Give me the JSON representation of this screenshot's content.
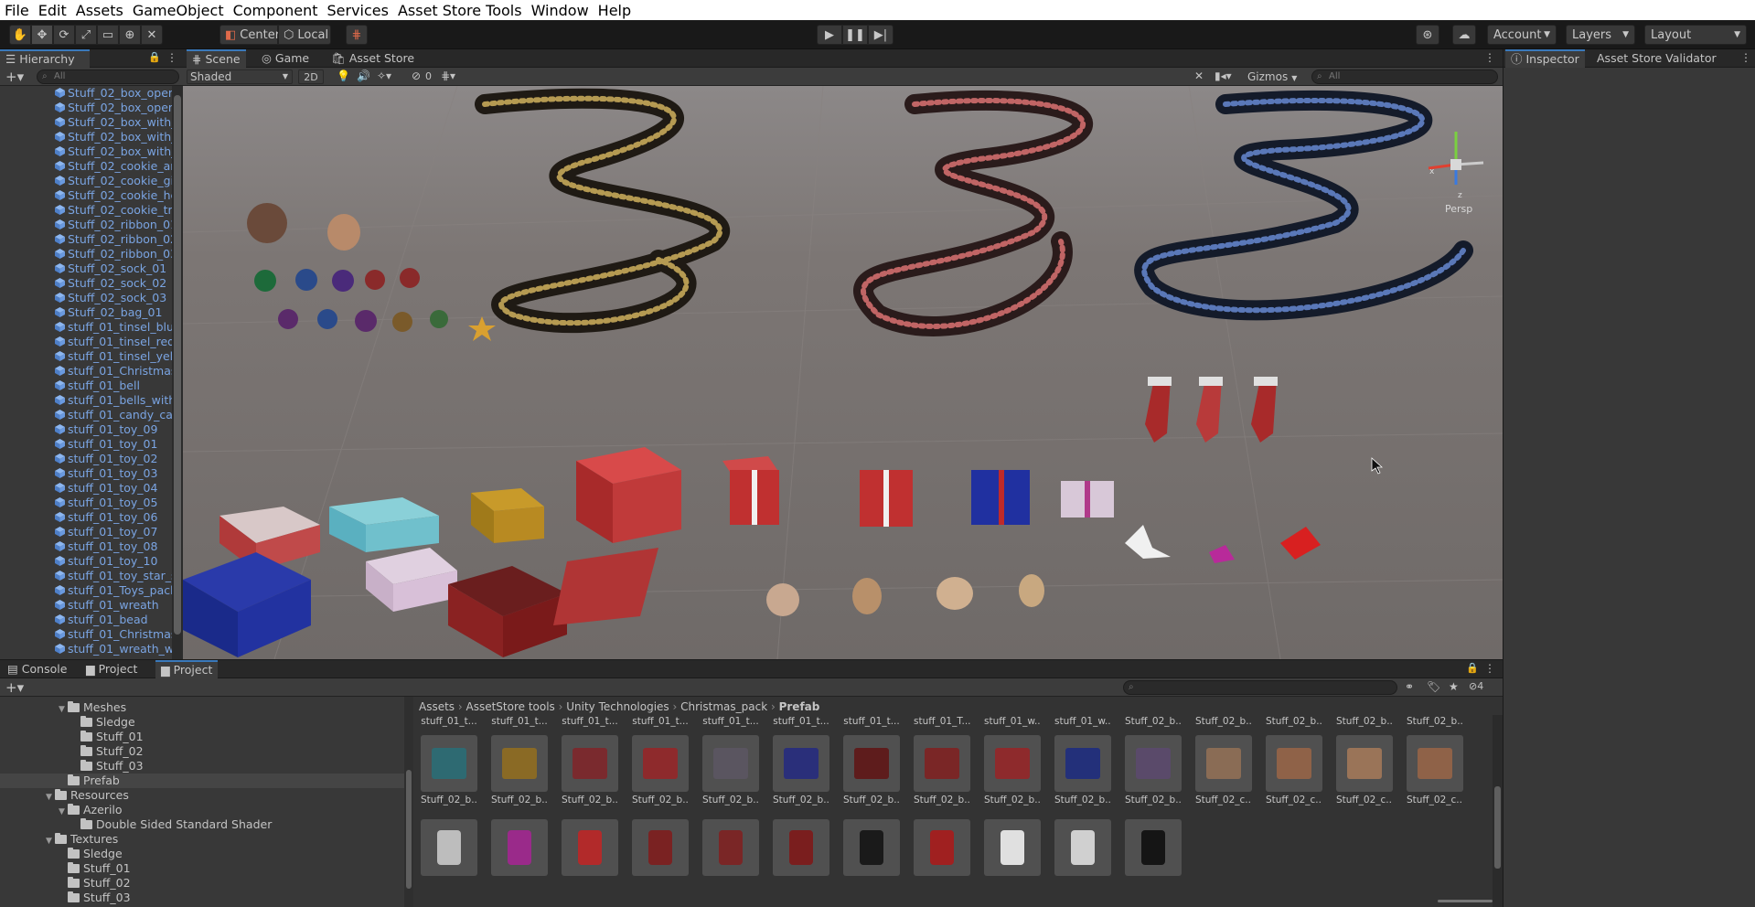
{
  "menu": [
    "File",
    "Edit",
    "Assets",
    "GameObject",
    "Component",
    "Services",
    "Asset Store Tools",
    "Window",
    "Help"
  ],
  "toolbar": {
    "pivot_label": "Center",
    "space_label": "Local",
    "account_label": "Account",
    "layers_label": "Layers",
    "layout_label": "Layout"
  },
  "hierarchy": {
    "tab": "Hierarchy",
    "search_placeholder": "All",
    "items": [
      "Stuff_02_box_open_",
      "Stuff_02_box_open_",
      "Stuff_02_box_with_",
      "Stuff_02_box_with_",
      "Stuff_02_box_with_",
      "Stuff_02_cookie_an",
      "Stuff_02_cookie_gi",
      "Stuff_02_cookie_he",
      "Stuff_02_cookie_tre",
      "Stuff_02_ribbon_01",
      "Stuff_02_ribbon_02",
      "Stuff_02_ribbon_03",
      "Stuff_02_sock_01",
      "Stuff_02_sock_02",
      "Stuff_02_sock_03",
      "Stuff_02_bag_01",
      "stuff_01_tinsel_blue",
      "stuff_01_tinsel_red",
      "stuff_01_tinsel_yello",
      "stuff_01_Christmas_",
      "stuff_01_bell",
      "stuff_01_bells_with_",
      "stuff_01_candy_car",
      "stuff_01_toy_09",
      "stuff_01_toy_01",
      "stuff_01_toy_02",
      "stuff_01_toy_03",
      "stuff_01_toy_04",
      "stuff_01_toy_05",
      "stuff_01_toy_06",
      "stuff_01_toy_07",
      "stuff_01_toy_08",
      "stuff_01_toy_10",
      "stuff_01_toy_star_sn",
      "stuff_01_Toys_pack",
      "stuff_01_wreath",
      "stuff_01_bead",
      "stuff_01_Christmas_",
      "stuff_01_wreath_wit"
    ]
  },
  "scene": {
    "tabs": [
      "Scene",
      "Game",
      "Asset Store"
    ],
    "shading": "Shaded",
    "mode_2d": "2D",
    "hidden_count": "0",
    "gizmos": "Gizmos",
    "search_placeholder": "All",
    "persp": "Persp",
    "axis_x": "x",
    "axis_z": "z"
  },
  "inspector": {
    "tabs": [
      "Inspector",
      "Asset Store Validator"
    ]
  },
  "bottom": {
    "tabs": [
      "Console",
      "Project",
      "Project"
    ],
    "hidden_count": "4"
  },
  "project_tree": [
    {
      "label": "Meshes",
      "depth": 1,
      "arrow": "▼"
    },
    {
      "label": "Sledge",
      "depth": 2,
      "arrow": ""
    },
    {
      "label": "Stuff_01",
      "depth": 2,
      "arrow": ""
    },
    {
      "label": "Stuff_02",
      "depth": 2,
      "arrow": ""
    },
    {
      "label": "Stuff_03",
      "depth": 2,
      "arrow": ""
    },
    {
      "label": "Prefab",
      "depth": 1,
      "arrow": "",
      "selected": true
    },
    {
      "label": "Resources",
      "depth": 0,
      "arrow": "▼"
    },
    {
      "label": "Azerilo",
      "depth": 1,
      "arrow": "▼"
    },
    {
      "label": "Double Sided Standard Shader",
      "depth": 2,
      "arrow": ""
    },
    {
      "label": "Textures",
      "depth": 0,
      "arrow": "▼"
    },
    {
      "label": "Sledge",
      "depth": 1,
      "arrow": ""
    },
    {
      "label": "Stuff_01",
      "depth": 1,
      "arrow": ""
    },
    {
      "label": "Stuff_02",
      "depth": 1,
      "arrow": ""
    },
    {
      "label": "Stuff_03",
      "depth": 1,
      "arrow": ""
    }
  ],
  "breadcrumb": [
    "Assets",
    "AssetStore tools",
    "Unity Technologies",
    "Christmas_pack",
    "Prefab"
  ],
  "grid_top_labels": [
    "stuff_01_t...",
    "stuff_01_t...",
    "stuff_01_t...",
    "stuff_01_t...",
    "stuff_01_t...",
    "stuff_01_t...",
    "stuff_01_t...",
    "stuff_01_T...",
    "stuff_01_w...",
    "stuff_01_w...",
    "Stuff_02_b...",
    "Stuff_02_b...",
    "Stuff_02_b...",
    "Stuff_02_b...",
    "Stuff_02_b..."
  ],
  "grid_row1": [
    {
      "label": "Stuff_02_b...",
      "color": "#2e6a72"
    },
    {
      "label": "Stuff_02_b...",
      "color": "#8a6a25"
    },
    {
      "label": "Stuff_02_b...",
      "color": "#7a2a2e"
    },
    {
      "label": "Stuff_02_b...",
      "color": "#8e2a2c"
    },
    {
      "label": "Stuff_02_b...",
      "color": "#5a5560"
    },
    {
      "label": "Stuff_02_b...",
      "color": "#2a2f7a"
    },
    {
      "label": "Stuff_02_b...",
      "color": "#5e1c1c"
    },
    {
      "label": "Stuff_02_b...",
      "color": "#7a2626"
    },
    {
      "label": "Stuff_02_b...",
      "color": "#8e2a2c"
    },
    {
      "label": "Stuff_02_b...",
      "color": "#23307a"
    },
    {
      "label": "Stuff_02_b...",
      "color": "#5a4a6a"
    },
    {
      "label": "Stuff_02_c...",
      "color": "#8a6c55"
    },
    {
      "label": "Stuff_02_c...",
      "color": "#8f6248"
    },
    {
      "label": "Stuff_02_c...",
      "color": "#9a7458"
    },
    {
      "label": "Stuff_02_c...",
      "color": "#8f6248"
    }
  ],
  "grid_row2": [
    {
      "color": "#bdbdbd"
    },
    {
      "color": "#9a2a8a"
    },
    {
      "color": "#b22a2a"
    },
    {
      "color": "#7a2222"
    },
    {
      "color": "#7a2626"
    },
    {
      "color": "#7a1e1e"
    },
    {
      "color": "#1a1a1a"
    },
    {
      "color": "#a02020"
    },
    {
      "color": "#e0e0e0"
    },
    {
      "color": "#d0d0d0"
    },
    {
      "color": "#151515"
    }
  ]
}
